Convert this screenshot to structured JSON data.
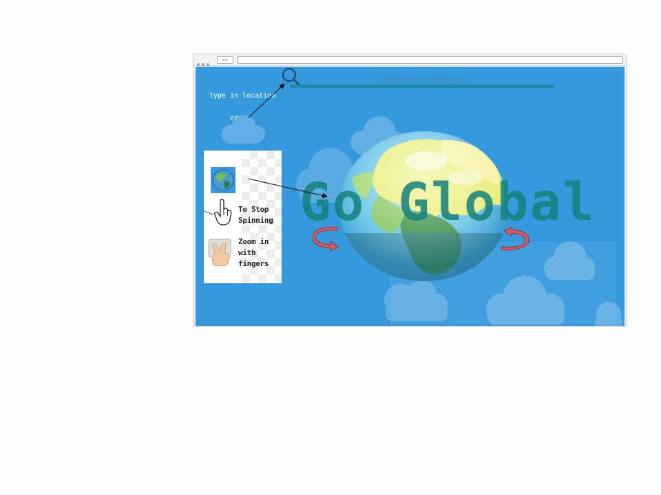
{
  "app": {
    "title": "Go Global"
  },
  "search": {
    "placeholder": "City/Country/Region"
  },
  "hints": {
    "type_location": "Type in location",
    "or": "or"
  },
  "panel": {
    "stop_spinning": [
      "To Stop",
      "Spinning"
    ],
    "zoom": [
      "Zoom in",
      "with",
      "fingers"
    ]
  },
  "icons": {
    "search": "search-icon",
    "globe": "globe-icon",
    "hand": "hand-pointer-icon",
    "pinch": "pinch-zoom-icon",
    "rotate_left": "rotate-left-icon",
    "rotate_right": "rotate-right-icon"
  },
  "colors": {
    "viewport_bg": "#3599dd",
    "title": "#13827a",
    "search_line": "#1d8ba6",
    "rotate_arrow": "#d9585b"
  }
}
